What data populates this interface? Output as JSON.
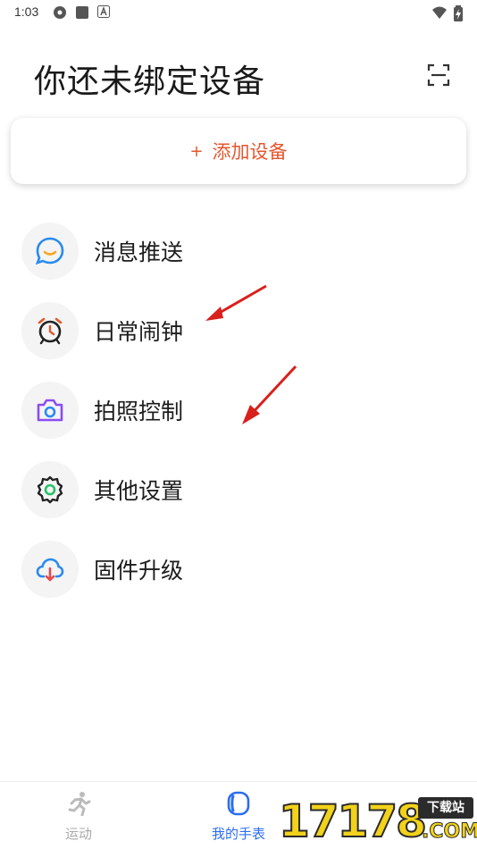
{
  "status_bar": {
    "time": "1:03",
    "icons": [
      "settings-app-icon",
      "square-app-icon",
      "a-app-icon"
    ],
    "right_icons": [
      "wifi-icon",
      "battery-charging-icon"
    ]
  },
  "header": {
    "title": "你还未绑定设备",
    "scan_icon": "scan-icon"
  },
  "add_device": {
    "plus": "+",
    "label": "添加设备",
    "color": "#e4572e"
  },
  "menu": {
    "items": [
      {
        "label": "消息推送",
        "icon": "message-icon",
        "color": "#2a8af0"
      },
      {
        "label": "日常闹钟",
        "icon": "alarm-clock-icon",
        "color": "#e4572e"
      },
      {
        "label": "拍照控制",
        "icon": "camera-icon",
        "color": "#8a4df0"
      },
      {
        "label": "其他设置",
        "icon": "gear-icon",
        "color": "#2bbf6a"
      },
      {
        "label": "固件升级",
        "icon": "cloud-download-icon",
        "color": "#e44b4b"
      }
    ]
  },
  "tabbar": {
    "tabs": [
      {
        "label": "运动",
        "icon": "running-icon",
        "active": false
      },
      {
        "label": "我的手表",
        "icon": "watch-icon",
        "active": true
      }
    ],
    "active_color": "#2a6df0"
  },
  "watermark": {
    "digits": "17178",
    "badge": "下载站",
    "suffix": ".COM"
  }
}
